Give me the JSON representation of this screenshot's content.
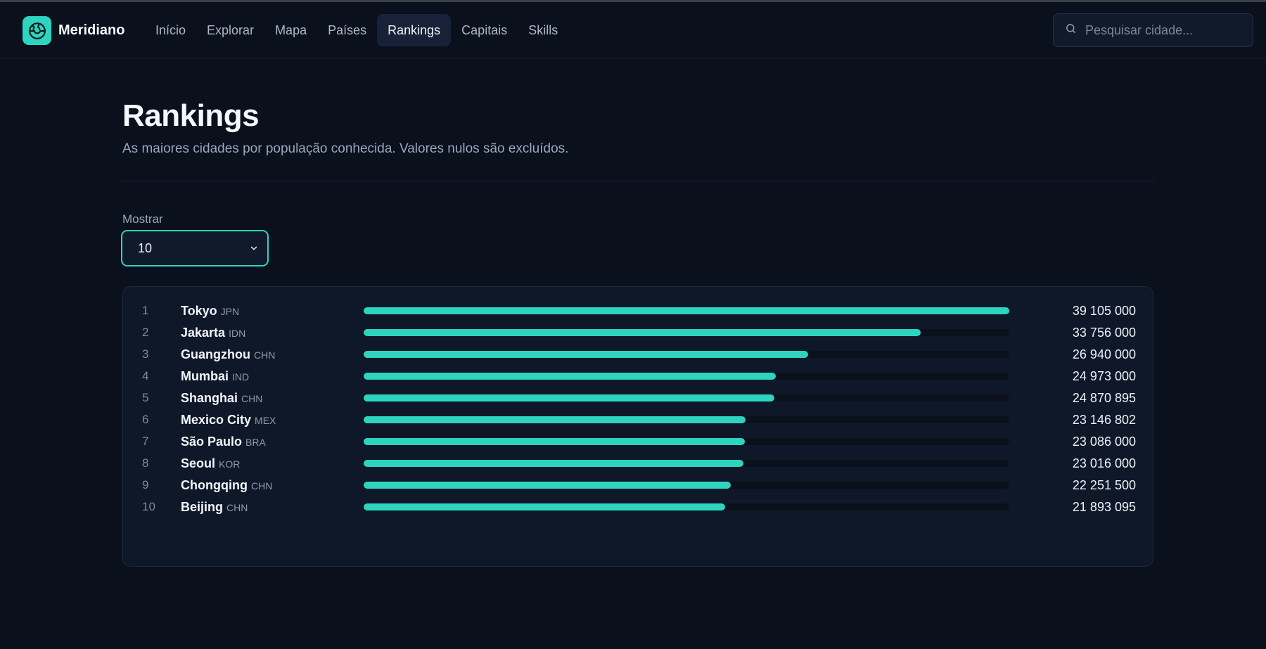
{
  "app": {
    "name": "Meridiano",
    "accent": "#2dd4bf"
  },
  "nav": {
    "items": [
      {
        "label": "Início",
        "active": false
      },
      {
        "label": "Explorar",
        "active": false
      },
      {
        "label": "Mapa",
        "active": false
      },
      {
        "label": "Países",
        "active": false
      },
      {
        "label": "Rankings",
        "active": true
      },
      {
        "label": "Capitais",
        "active": false
      },
      {
        "label": "Skills",
        "active": false
      }
    ]
  },
  "search": {
    "placeholder": "Pesquisar cidade...",
    "value": ""
  },
  "page": {
    "title": "Rankings",
    "subtitle": "As maiores cidades por população conhecida. Valores nulos são excluídos.",
    "show_label": "Mostrar",
    "show_value": "10"
  },
  "ranking": [
    {
      "rank": "1",
      "city": "Tokyo",
      "code": "JPN",
      "population": "39 105 000",
      "share": 1.0
    },
    {
      "rank": "2",
      "city": "Jakarta",
      "code": "IDN",
      "population": "33 756 000",
      "share": 0.8632
    },
    {
      "rank": "3",
      "city": "Guangzhou",
      "code": "CHN",
      "population": "26 940 000",
      "share": 0.6889
    },
    {
      "rank": "4",
      "city": "Mumbai",
      "code": "IND",
      "population": "24 973 000",
      "share": 0.6386
    },
    {
      "rank": "5",
      "city": "Shanghai",
      "code": "CHN",
      "population": "24 870 895",
      "share": 0.636
    },
    {
      "rank": "6",
      "city": "Mexico City",
      "code": "MEX",
      "population": "23 146 802",
      "share": 0.5919
    },
    {
      "rank": "7",
      "city": "São Paulo",
      "code": "BRA",
      "population": "23 086 000",
      "share": 0.5904
    },
    {
      "rank": "8",
      "city": "Seoul",
      "code": "KOR",
      "population": "23 016 000",
      "share": 0.5886
    },
    {
      "rank": "9",
      "city": "Chongqing",
      "code": "CHN",
      "population": "22 251 500",
      "share": 0.569
    },
    {
      "rank": "10",
      "city": "Beijing",
      "code": "CHN",
      "population": "21 893 095",
      "share": 0.5598
    }
  ]
}
